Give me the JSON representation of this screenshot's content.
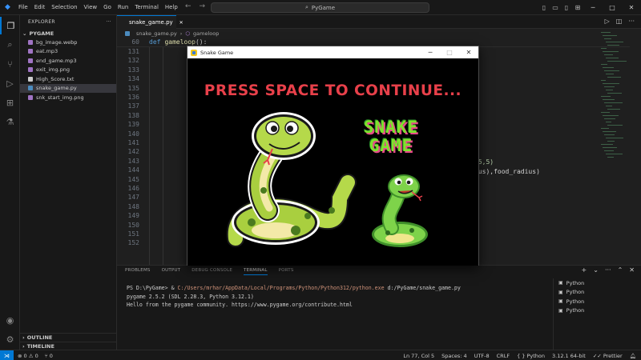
{
  "titlebar": {
    "menu": [
      "File",
      "Edit",
      "Selection",
      "View",
      "Go",
      "Run",
      "Terminal",
      "Help"
    ],
    "search_text": "PyGame"
  },
  "explorer": {
    "header": "EXPLORER",
    "folder": "PYGAME",
    "files": [
      {
        "name": "bg_image.webp",
        "icon_color": "#a074c4"
      },
      {
        "name": "eat.mp3",
        "icon_color": "#a074c4"
      },
      {
        "name": "end_game.mp3",
        "icon_color": "#a074c4"
      },
      {
        "name": "exit_img.png",
        "icon_color": "#a074c4"
      },
      {
        "name": "High_Score.txt",
        "icon_color": "#cccccc"
      },
      {
        "name": "snake_game.py",
        "icon_color": "#4b8bbe"
      },
      {
        "name": "snk_start_img.png",
        "icon_color": "#a074c4"
      }
    ],
    "outline_label": "OUTLINE",
    "timeline_label": "TIMELINE"
  },
  "editor": {
    "tab_label": "snake_game.py",
    "breadcrumb_file": "snake_game.py",
    "breadcrumb_symbol": "gameloop",
    "sticky_line_number": "60",
    "sticky_keyword": "def",
    "sticky_function": "gameloop",
    "sticky_rest": "():",
    "line_numbers": [
      "131",
      "132",
      "133",
      "134",
      "135",
      "136",
      "137",
      "138",
      "139",
      "140",
      "141",
      "142",
      "143",
      "144",
      "145",
      "146",
      "147",
      "148",
      "149",
      "150",
      "151",
      "152"
    ],
    "visible_code_fragments": {
      "line_142": ",5,5)",
      "line_143": "ius),food_radius)"
    }
  },
  "panel": {
    "tabs": [
      "PROBLEMS",
      "OUTPUT",
      "DEBUG CONSOLE",
      "TERMINAL",
      "PORTS"
    ],
    "active_tab": "TERMINAL",
    "terminal_prompt": "PS D:\\PyGame> & ",
    "terminal_python_path": "C:/Users/mrhar/AppData/Local/Programs/Python/Python312/python.exe",
    "terminal_script": " d:/PyGame/snake_game.py",
    "terminal_line2": "pygame 2.5.2 (SDL 2.28.3, Python 3.12.1)",
    "terminal_line3": "Hello from the pygame community. https://www.pygame.org/contribute.html",
    "terminal_instances": [
      "Python",
      "Python",
      "Python",
      "Python"
    ]
  },
  "statusbar": {
    "errors": "0",
    "warnings": "0",
    "ports": "0",
    "position": "Ln 77, Col 5",
    "spaces": "Spaces: 4",
    "encoding": "UTF-8",
    "eol": "CRLF",
    "language": "Python",
    "interpreter": "3.12.1 64-bit",
    "formatter": "Prettier"
  },
  "game_window": {
    "title": "Snake Game",
    "message": "PRESS SPACE TO CONTINUE...",
    "logo_line1": "SNAKE",
    "logo_line2": "GAME"
  },
  "colors": {
    "accent": "#0078d4",
    "message_red": "#e8404a",
    "logo_green": "#7ee32c",
    "snake_green": "#8cc63f"
  }
}
